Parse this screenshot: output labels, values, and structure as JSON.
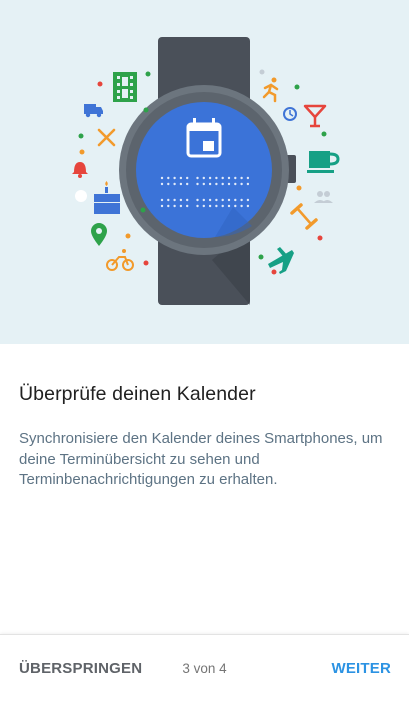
{
  "hero": {
    "watch_icon": "calendar-icon",
    "icons": [
      "film-icon",
      "truck-icon",
      "fork-knife-icon",
      "alarm-bell-icon",
      "birthday-cake-icon",
      "map-pin-icon",
      "cyclist-icon",
      "runner-icon",
      "alarm-clock-icon",
      "cocktail-icon",
      "coffee-cup-icon",
      "people-icon",
      "dumbbell-icon",
      "airplane-icon"
    ],
    "colors": {
      "background": "#e5f1f5",
      "band": "#4a5059",
      "bezel": "#6c757e",
      "face": "#3b73d8",
      "green": "#2ea24a",
      "orange": "#f29a2b",
      "red": "#e6453c",
      "teal": "#16a085",
      "blue": "#3f74d6",
      "gray": "#c4cdd5"
    }
  },
  "content": {
    "title": "Überprüfe deinen Kalender",
    "description": "Synchronisiere den Kalender deines Smartphones, um deine Terminübersicht zu sehen und Terminbenachrichtigungen zu erhalten."
  },
  "footer": {
    "skip_label": "ÜBERSPRINGEN",
    "pager_text": "3 von 4",
    "next_label": "WEITER"
  }
}
